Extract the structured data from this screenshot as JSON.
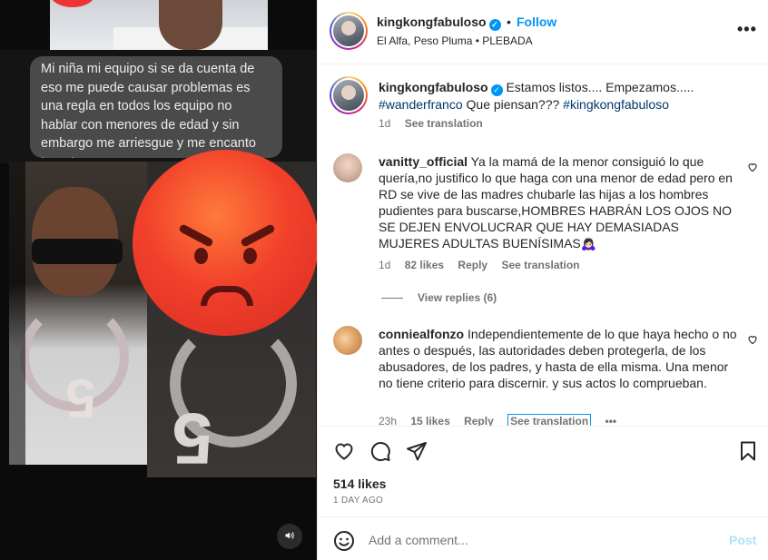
{
  "media": {
    "chat_text": "Mi niña mi equipo si se da cuenta de eso me puede causar problemas es una regla en todos los equipo no hablar con menores de edad y sin embargo me arriesgue y me encanto tenerte",
    "pendant_left": "5",
    "pendant_right": "5",
    "mute_icon": "speaker-icon"
  },
  "header": {
    "username": "kingkongfabuloso",
    "separator": "•",
    "follow_label": "Follow",
    "subtitle": "El Alfa, Peso Pluma • PLEBADA",
    "more_label": "•••"
  },
  "caption": {
    "username": "kingkongfabuloso",
    "text": "Estamos listos.... Empezamos.....",
    "tag1": "#wanderfranco",
    "middle": " Que piensan??? ",
    "tag2": "#kingkongfabuloso",
    "time": "1d",
    "see_translation": "See translation"
  },
  "comments": [
    {
      "username": "vanitty_official",
      "text": "Ya la mamá de la menor consiguió lo que quería,no justifico lo que haga con una menor de edad pero en RD se vive de las madres chubarle las hijas a los hombres pudientes para buscarse,HOMBRES HABRÁN LOS OJOS NO SE DEJEN ENVOLUCRAR QUE HAY DEMASIADAS MUJERES ADULTAS BUENÍSIMAS🙇🏻‍♀️",
      "time": "1d",
      "likes": "82 likes",
      "reply": "Reply",
      "see_translation": "See translation",
      "view_replies": "View replies (6)"
    },
    {
      "username": "conniealfonzo",
      "text": "Independientemente de lo que haya hecho o no antes o después, las autoridades deben protegerla, de los abusadores, de los padres, y hasta de ella misma. Una menor no tiene criterio para discernir. y sus actos lo comprueban.",
      "time": "23h",
      "likes": "15 likes",
      "reply": "Reply",
      "see_translation": "See translation",
      "more": "•••"
    }
  ],
  "actions": {
    "likes": "514 likes",
    "when": "1 DAY AGO"
  },
  "add_comment": {
    "placeholder": "Add a comment...",
    "post_label": "Post"
  },
  "colors": {
    "accent": "#0095f6",
    "hashtag": "#00376b",
    "muted": "#737373",
    "post_disabled": "#b2dffc"
  }
}
